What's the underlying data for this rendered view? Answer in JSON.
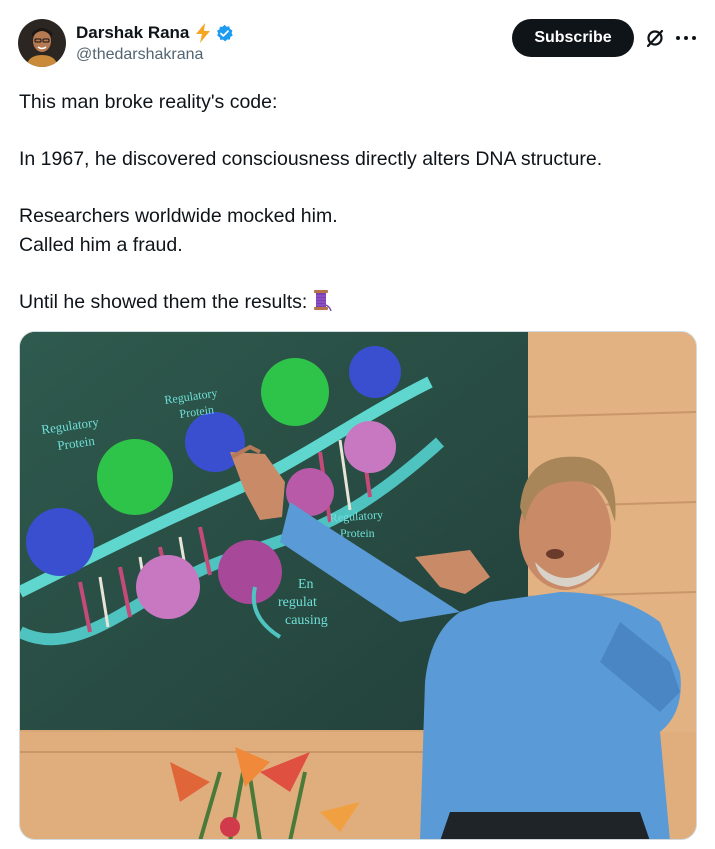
{
  "author": {
    "display_name": "Darshak Rana",
    "handle": "@thedarshakrana",
    "badge_icon": "lightning-bolt-icon",
    "verified_icon": "verified-badge-icon",
    "verified_color": "#1d9bf0"
  },
  "actions": {
    "subscribe_label": "Subscribe",
    "grok_icon": "grok-icon",
    "more_icon": "more-options-icon"
  },
  "tweet": {
    "lines": [
      "This man broke reality's code:",
      "",
      "In 1967, he discovered consciousness directly alters DNA structure.",
      "",
      "Researchers worldwide mocked him.",
      "Called him a fraud.",
      "",
      "Until he showed them the results:"
    ],
    "trailing_emoji": "thread-spool-emoji"
  },
  "media": {
    "slide_labels": {
      "left": [
        "Regulatory",
        "Protein"
      ],
      "top": [
        "Regulatory",
        "Protein"
      ],
      "right": [
        "Regulatory",
        "Protein"
      ],
      "bottom": [
        "En",
        "regulat",
        "causing"
      ]
    }
  },
  "colors": {
    "text": "#0f1419",
    "secondary": "#536471",
    "button_bg": "#0f1419"
  }
}
